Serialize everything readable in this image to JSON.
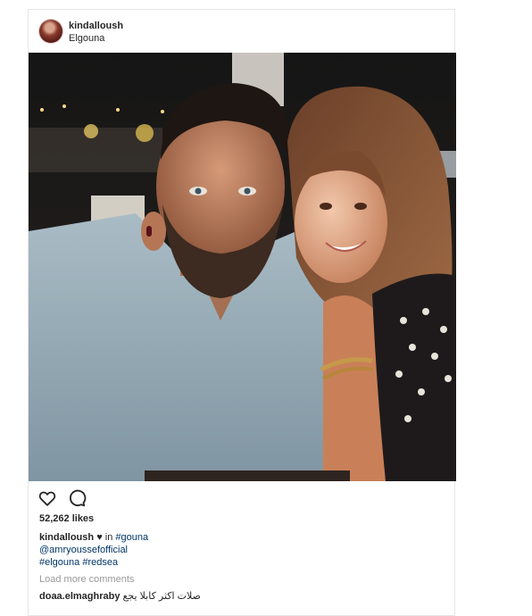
{
  "post": {
    "username": "kindalloush",
    "location": "Elgouna",
    "likes": "52,262 likes",
    "caption": {
      "username": "kindalloush",
      "heart": "♥",
      "in_text": "in",
      "tag_gouna": "#gouna",
      "mention": "@amryoussefofficial",
      "tag_elgouna": "#elgouna",
      "tag_redsea": "#redsea"
    },
    "load_more": "Load more comments",
    "comment": {
      "username": "doaa.elmaghraby",
      "text": "صلات اكثر كابلا يجع"
    }
  },
  "icons": {
    "like": "heart-outline-icon",
    "comment": "speech-bubble-icon"
  },
  "colors": {
    "link": "#003569",
    "muted": "#999999",
    "text": "#262626",
    "border": "#e6e6e6"
  }
}
